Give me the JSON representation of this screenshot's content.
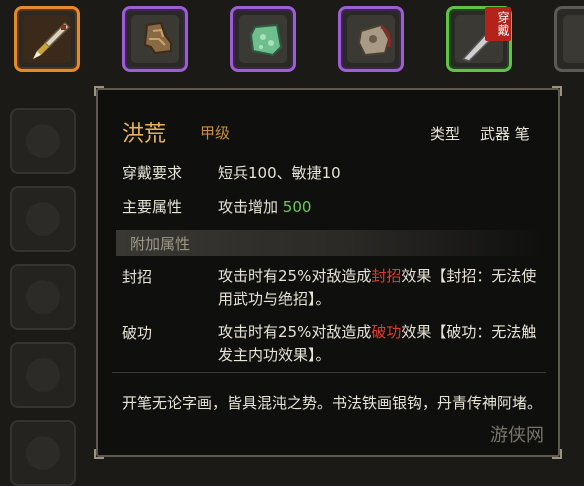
{
  "slots": [
    {
      "name": "brush-item",
      "rarity": "orange"
    },
    {
      "name": "boots-item",
      "rarity": "purple"
    },
    {
      "name": "jade-item",
      "rarity": "purple"
    },
    {
      "name": "bag-item",
      "rarity": "purple"
    },
    {
      "name": "knife-item",
      "rarity": "green",
      "tag": "穿戴"
    },
    {
      "name": "empty-slot",
      "rarity": "gray"
    }
  ],
  "item": {
    "name": "洪荒",
    "grade": "甲级",
    "type_label": "类型",
    "type_value": "武器 笔",
    "requirement_label": "穿戴要求",
    "requirement_value": "短兵100、敏捷10",
    "main_attr_label": "主要属性",
    "main_attr_prefix": "攻击增加",
    "main_attr_value": "500",
    "extra_section": "附加属性",
    "effects": [
      {
        "label": "封招",
        "pre": "攻击时有25%对敌造成",
        "highlight": "封招",
        "post": "效果【封招：无法使用武功与绝招】。"
      },
      {
        "label": "破功",
        "pre": "攻击时有25%对敌造成",
        "highlight": "破功",
        "post": "效果【破功：无法触发主内功效果】。"
      }
    ],
    "flavor": "开笔无论字画，皆具混沌之势。书法铁画银钩，丹青传神阿堵。"
  },
  "watermark": "游侠网",
  "colors": {
    "name": "#e6b45a",
    "grade": "#c68d3a",
    "highlight": "#e23b2b",
    "value_green": "#67d04f"
  }
}
